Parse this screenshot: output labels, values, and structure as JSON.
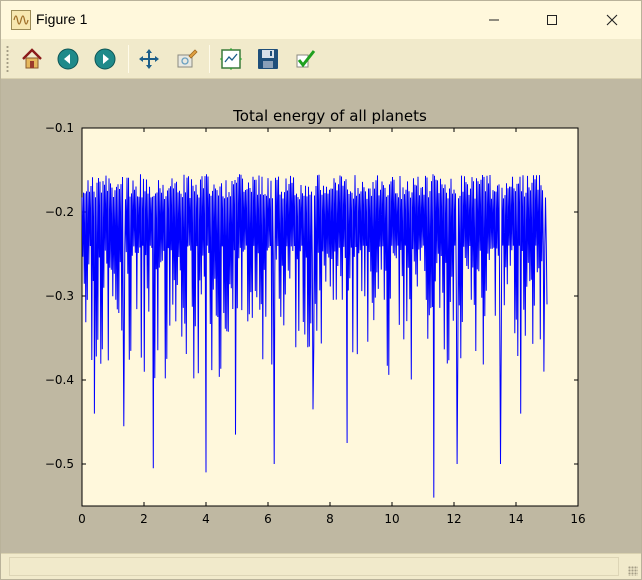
{
  "window": {
    "title": "Figure 1",
    "controls": {
      "minimize": "—",
      "maximize": "☐",
      "close": "✕"
    }
  },
  "toolbar": {
    "buttons": [
      {
        "name": "home-icon",
        "tooltip": "Reset original view"
      },
      {
        "name": "back-icon",
        "tooltip": "Back to previous view"
      },
      {
        "name": "forward-icon",
        "tooltip": "Forward to next view"
      },
      {
        "name": "pan-icon",
        "tooltip": "Pan axes"
      },
      {
        "name": "zoom-icon",
        "tooltip": "Zoom to rectangle"
      },
      {
        "name": "subplots-icon",
        "tooltip": "Configure subplots"
      },
      {
        "name": "save-icon",
        "tooltip": "Save the figure"
      },
      {
        "name": "edit-icon",
        "tooltip": "Edit curve parameters"
      }
    ]
  },
  "status": {
    "text": ""
  },
  "colors": {
    "line": "#0000ff",
    "axes_bg": "#fff8dc",
    "figure_bg": "#bfb8a2",
    "toolbar_bg": "#f1eacb"
  },
  "chart_data": {
    "type": "line",
    "title": "Total energy of all planets",
    "xlabel": "",
    "ylabel": "",
    "xlim": [
      0,
      16
    ],
    "ylim": [
      -0.55,
      -0.1
    ],
    "xticks": [
      0,
      2,
      4,
      6,
      8,
      10,
      12,
      14,
      16
    ],
    "xtick_labels": [
      "0",
      "2",
      "4",
      "6",
      "8",
      "10",
      "12",
      "14",
      "16"
    ],
    "yticks": [
      -0.1,
      -0.2,
      -0.3,
      -0.4,
      -0.5
    ],
    "ytick_labels": [
      "−0.1",
      "−0.2",
      "−0.3",
      "−0.4",
      "−0.5"
    ],
    "grid": false,
    "series": [
      {
        "color": "#0000ff",
        "x_start": 0,
        "x_end": 15,
        "baseline": -0.22,
        "upper": -0.155,
        "notable_points": [
          {
            "x": 0.4,
            "y": -0.44
          },
          {
            "x": 1.35,
            "y": -0.455
          },
          {
            "x": 2.3,
            "y": -0.505
          },
          {
            "x": 4.0,
            "y": -0.51
          },
          {
            "x": 4.95,
            "y": -0.465
          },
          {
            "x": 6.2,
            "y": -0.5
          },
          {
            "x": 7.45,
            "y": -0.435
          },
          {
            "x": 8.55,
            "y": -0.475
          },
          {
            "x": 11.35,
            "y": -0.54
          },
          {
            "x": 12.1,
            "y": -0.5
          },
          {
            "x": 13.5,
            "y": -0.5
          },
          {
            "x": 14.15,
            "y": -0.44
          },
          {
            "x": 14.9,
            "y": -0.39
          },
          {
            "x": 15.0,
            "y": -0.31
          }
        ]
      }
    ]
  }
}
